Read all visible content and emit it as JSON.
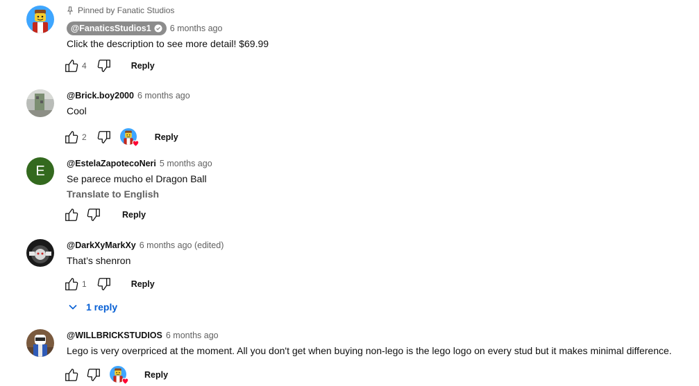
{
  "comments": [
    {
      "pinned_label": "Pinned by Fanatic Studios",
      "author": "@FanaticsStudios1",
      "time": "6 months ago",
      "text": "Click the description to see more detail! $69.99",
      "likes": "4",
      "reply": "Reply",
      "avatar": "lego-minifig-avatar"
    },
    {
      "author": "@Brick.boy2000",
      "time": "6 months ago",
      "text": "Cool",
      "likes": "2",
      "reply": "Reply",
      "avatar": "photo-avatar-gray"
    },
    {
      "author": "@EstelaZapotecoNeri",
      "time": "5 months ago",
      "text": "Se parece mucho el Dragon Ball",
      "translate": "Translate to English",
      "reply": "Reply",
      "avatar_letter": "E",
      "avatar_color": "#33691e"
    },
    {
      "author": "@DarkXyMarkXy",
      "time": "6 months ago (edited)",
      "text": "That’s shenron",
      "likes": "1",
      "reply": "Reply",
      "replies_label": "1 reply",
      "avatar": "photo-avatar-dark"
    },
    {
      "author": "@WILLBRICKSTUDIOS",
      "time": "6 months ago",
      "text": "Lego is very overpriced at the moment. All you don't get when buying non-lego is the lego logo on every stud but it makes minimal difference.",
      "reply": "Reply",
      "avatar": "photo-avatar-minifig"
    }
  ],
  "colors": {
    "link_blue": "#065fd4",
    "secondary_text": "#606060",
    "heart_red": "#ff0033",
    "chip_gray": "#8c8c8c"
  }
}
